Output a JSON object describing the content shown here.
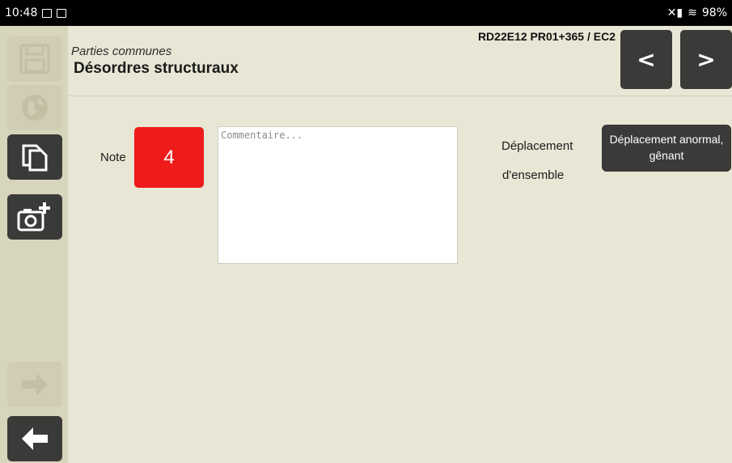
{
  "status_bar": {
    "time": "10:48",
    "battery": "98%"
  },
  "header": {
    "subtitle": "Parties communes",
    "title": "Désordres structuraux",
    "code": "RD22E12 PR01+365 / EC2",
    "prev_label": "<",
    "next_label": ">"
  },
  "sidebar": {
    "items": [
      {
        "name": "save",
        "icon": "floppy-disk-icon",
        "enabled": false
      },
      {
        "name": "globe",
        "icon": "globe-icon",
        "enabled": false
      },
      {
        "name": "copy",
        "icon": "copy-documents-icon",
        "enabled": true
      },
      {
        "name": "add-photo",
        "icon": "camera-plus-icon",
        "enabled": true
      },
      {
        "name": "next",
        "icon": "arrow-right-icon",
        "enabled": false
      },
      {
        "name": "back",
        "icon": "arrow-left-icon",
        "enabled": true
      }
    ]
  },
  "form": {
    "note_label": "Note",
    "note_value": "4",
    "comment_placeholder": "Commentaire...",
    "comment_value": "",
    "displacement_label_line1": "Déplacement",
    "displacement_label_line2": "d'ensemble",
    "displacement_value": "Déplacement anormal, gênant"
  },
  "colors": {
    "background": "#e8e6d4",
    "sidebar": "#d8d5bd",
    "dark_button": "#3a3a38",
    "note_red": "#ef1b1b"
  }
}
